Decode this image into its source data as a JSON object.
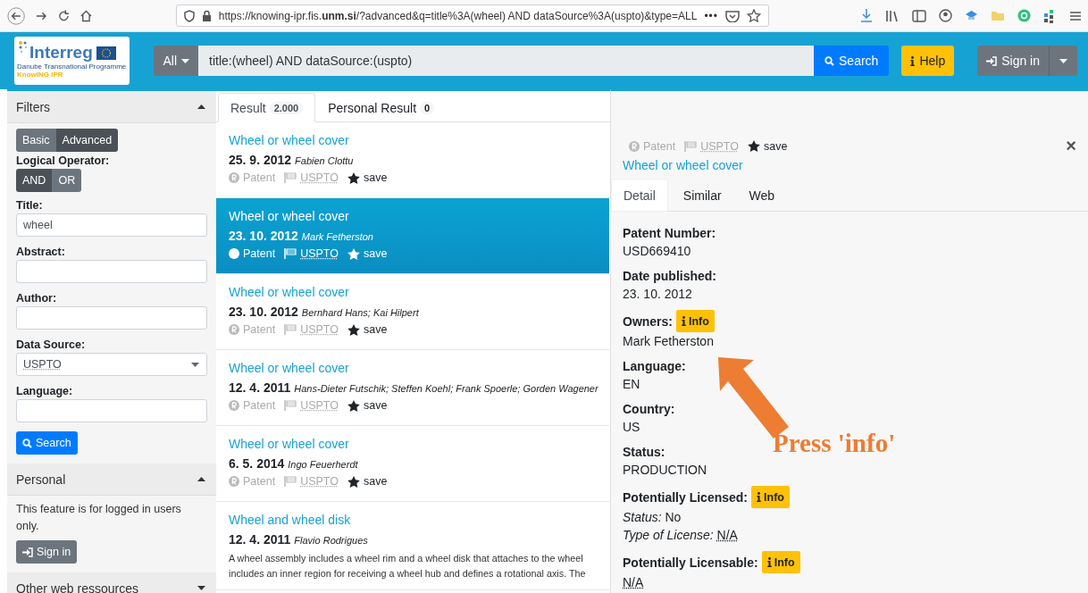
{
  "browser": {
    "url": "https://knowing-ipr.fis.**unm.si**/?advanced&q=title%3A(wheel) AND dataSource%3A(uspto)&type=ALL",
    "menu": "•••"
  },
  "header": {
    "logo": {
      "title": "Interreg",
      "subtitle": "Danube Transnational Programme",
      "project": "KnowING IPR"
    },
    "scope": "All",
    "query": "title:(wheel) AND dataSource:(uspto)",
    "search": "Search",
    "help": "Help",
    "sign_in": "Sign in"
  },
  "sidebar": {
    "filters": {
      "title": "Filters",
      "expanded": true,
      "mode": [
        {
          "label": "Basic",
          "selected": false
        },
        {
          "label": "Advanced",
          "selected": true
        }
      ],
      "operator_label": "Logical Operator:",
      "operators": [
        {
          "label": "AND",
          "selected": true
        },
        {
          "label": "OR",
          "selected": false
        }
      ],
      "fields": [
        {
          "label": "Title:",
          "kind": "text",
          "value": "wheel"
        },
        {
          "label": "Abstract:",
          "kind": "text"
        },
        {
          "label": "Author:",
          "kind": "text"
        },
        {
          "label": "Data Source:",
          "kind": "select",
          "value": "USPTO"
        },
        {
          "label": "Language:",
          "kind": "text"
        }
      ],
      "search": "Search"
    },
    "personal": {
      "title": "Personal",
      "expanded": true,
      "note": "This feature is for logged in users only.",
      "sign_in": "Sign in"
    },
    "other": {
      "title": "Other web ressources",
      "expanded": false
    }
  },
  "results": {
    "tabs": [
      {
        "label": "Result",
        "count": "2.000",
        "selected": true
      },
      {
        "label": "Personal Result",
        "count": "0",
        "selected": false
      }
    ],
    "items": [
      {
        "title": "Wheel or wheel cover",
        "date": "25. 9. 2012",
        "authors": "Fabien Clottu",
        "type": "Patent",
        "source": "USPTO",
        "save": "save",
        "selected": false
      },
      {
        "title": "Wheel or wheel cover",
        "date": "23. 10. 2012",
        "authors": "Mark Fetherston",
        "type": "Patent",
        "source": "USPTO",
        "save": "save",
        "selected": true
      },
      {
        "title": "Wheel or wheel cover",
        "date": "23. 10. 2012",
        "authors": "Bernhard Hans; Kai Hilpert",
        "type": "Patent",
        "source": "USPTO",
        "save": "save",
        "selected": false
      },
      {
        "title": "Wheel or wheel cover",
        "date": "12. 4. 2011",
        "authors": "Hans-Dieter Futschik; Steffen Koehl; Frank Spoerle; Gorden Wagener",
        "type": "Patent",
        "source": "USPTO",
        "save": "save",
        "selected": false
      },
      {
        "title": "Wheel or wheel cover",
        "date": "6. 5. 2014",
        "authors": "Ingo Feuerherdt",
        "type": "Patent",
        "source": "USPTO",
        "save": "save",
        "selected": false
      },
      {
        "title": "Wheel and wheel disk",
        "date": "12. 4. 2011",
        "authors": "Flavio Rodrigues",
        "abstract": [
          "A wheel assembly includes a wheel rim and a wheel disk that attaches to the wheel",
          "includes an inner region for receiving a wheel hub and defines a rotational axis. The"
        ],
        "selected": false
      }
    ]
  },
  "detail": {
    "type": "Patent",
    "source": "USPTO",
    "save": "save",
    "close": "×",
    "title": "Wheel or wheel cover",
    "tabs": [
      {
        "label": "Detail",
        "selected": true
      },
      {
        "label": "Similar",
        "selected": false
      },
      {
        "label": "Web",
        "selected": false
      }
    ],
    "fields": [
      {
        "label": "Patent Number:",
        "value": "USD669410"
      },
      {
        "label": "Date published:",
        "value": "23. 10. 2012"
      },
      {
        "label": "Owners:",
        "info": "Info",
        "value": "Mark Fetherston"
      },
      {
        "label": "Language:",
        "value": "EN"
      },
      {
        "label": "Country:",
        "value": "US"
      },
      {
        "label": "Status:",
        "value": "PRODUCTION"
      },
      {
        "label": "Potentially Licensed:",
        "info": "Info",
        "lines": [
          {
            "key": "Status:",
            "value": "No",
            "abbreviation": false
          },
          {
            "key": "Type of License:",
            "value": "N/A",
            "abbreviation": true
          }
        ]
      },
      {
        "label": "Potentially Licensable:",
        "info": "Info",
        "value": "N/A",
        "abbreviation": true
      }
    ]
  },
  "annotation": {
    "text": "Press 'info'"
  }
}
